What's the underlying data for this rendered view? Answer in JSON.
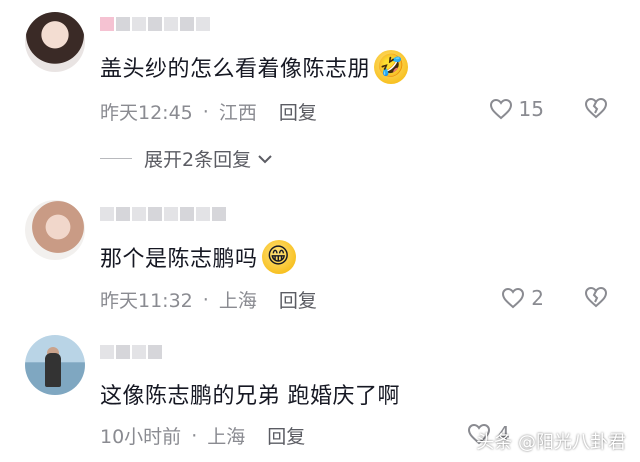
{
  "comments": [
    {
      "text": "盖头纱的怎么看着像陈志朋",
      "emoji": "🤣",
      "time": "昨天12:45",
      "location": "江西",
      "reply": "回复",
      "likes": "15",
      "expand_replies": "展开2条回复"
    },
    {
      "text": "那个是陈志鹏吗",
      "emoji": "😁",
      "time": "昨天11:32",
      "location": "上海",
      "reply": "回复",
      "likes": "2"
    },
    {
      "text": "这像陈志鹏的兄弟 跑婚庆了啊",
      "time": "10小时前",
      "location": "上海",
      "reply": "回复",
      "likes": "4"
    }
  ],
  "separator": "·",
  "watermark": "头条 @阳光八卦君",
  "icons": {
    "like": "heart-outline-icon",
    "dislike": "broken-heart-icon",
    "expand": "chevron-down-icon"
  },
  "colors": {
    "text": "#161823",
    "meta": "#8a8b91",
    "emoji": "#f5b400"
  }
}
